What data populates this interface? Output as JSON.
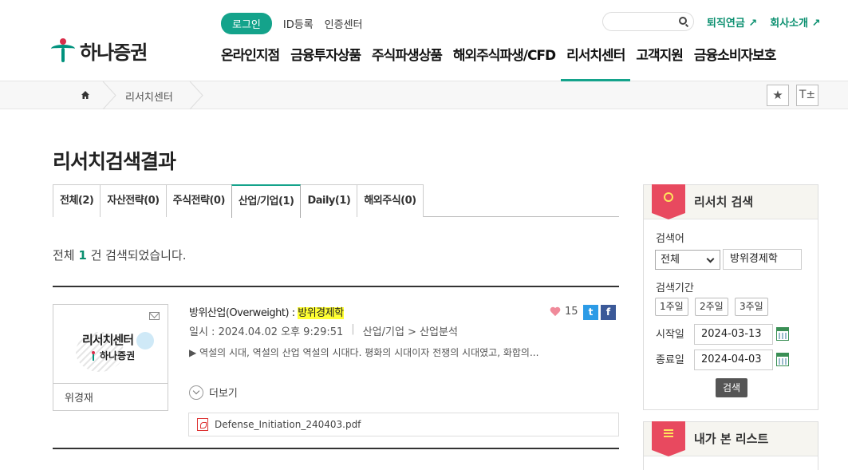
{
  "header": {
    "logo_text": "하나증권",
    "login_label": "로그인",
    "top_links": [
      "ID등록",
      "인증센터"
    ],
    "util_links": [
      "퇴직연금 ↗",
      "회사소개 ↗"
    ],
    "gnb": [
      "온라인지점",
      "금융투자상품",
      "주식파생상품",
      "해외주식파생/CFD",
      "리서치센터",
      "고객지원",
      "금융소비자보호"
    ],
    "gnb_active": "리서치센터"
  },
  "breadcrumb": {
    "home_icon": "home-icon",
    "current": "리서치센터",
    "fav_symbol": "★",
    "font_symbol": "T±"
  },
  "page": {
    "title": "리서치검색결과",
    "tabs": [
      "전체(2)",
      "자산전략(0)",
      "주식전략(0)",
      "산업/기업(1)",
      "Daily(1)",
      "해외주식(0)"
    ],
    "active_tab": "산업/기업(1)",
    "result_prefix": "전체 ",
    "result_count": "1",
    "result_suffix": " 건 검색되었습니다."
  },
  "result": {
    "thumb_title": "리서치센터",
    "thumb_logo": "하나증권",
    "author": "위경재",
    "title_prefix": "방위산업(Overweight) : ",
    "title_highlight": "방위경제학",
    "date_label": "일시 : 2024.04.02  오후 9:29:51",
    "category": "산업/기업 > 산업분석",
    "summary": "▶ 역설의 시대, 역설의 산업 역설의 시대다. 평화의 시대이자 전쟁의 시대였고, 화합의...",
    "likes": "15",
    "twitter_glyph": "t",
    "facebook_glyph": "f",
    "more_label": "더보기",
    "attachment": "Defense_Initiation_240403.pdf",
    "highlight_color": "#ffff33"
  },
  "sidebar": {
    "search_title": "리서치 검색",
    "keyword_label": "검색어",
    "scope_value": "전체",
    "keyword_value": "방위경제학",
    "period_label": "검색기간",
    "period_buttons": [
      "1주일",
      "2주일",
      "3주일"
    ],
    "start_label": "시작일",
    "start_value": "2024-03-13",
    "end_label": "종료일",
    "end_value": "2024-04-03",
    "search_button": "검색",
    "recent_title": "내가 본 리스트"
  },
  "colors": {
    "accent": "#14a38b",
    "badge": "#e8495f"
  }
}
